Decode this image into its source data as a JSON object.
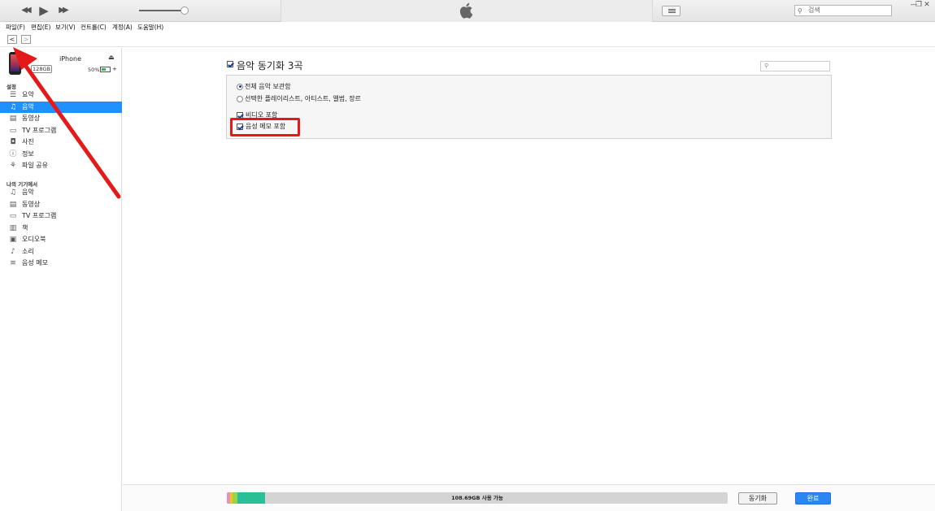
{
  "toolbar": {
    "prev_icon": "◀◀",
    "play_icon": "▶",
    "next_icon": "▶▶",
    "search_placeholder": "검색",
    "window_min": "—",
    "window_max": "❐",
    "window_close": "✕"
  },
  "menu": [
    "파일(F)",
    "편집(E)",
    "보기(V)",
    "컨트롤(C)",
    "계정(A)",
    "도움말(H)"
  ],
  "nav": {
    "back": "<",
    "forward": ">"
  },
  "device": {
    "name": "iPhone",
    "capacity": "128GB",
    "battery_percent": "50%",
    "battery_level": 0.5,
    "charging_symbol": "+"
  },
  "sidebar": {
    "settings_header": "설정",
    "settings_items": [
      {
        "icon": "☰",
        "label": "요약"
      },
      {
        "icon": "♫",
        "label": "음악"
      },
      {
        "icon": "▤",
        "label": "동영상"
      },
      {
        "icon": "▭",
        "label": "TV 프로그램"
      },
      {
        "icon": "◘",
        "label": "사진"
      },
      {
        "icon": "ⓘ",
        "label": "정보"
      },
      {
        "icon": "⚘",
        "label": "파일 공유"
      }
    ],
    "device_header": "나의 기기에서",
    "device_items": [
      {
        "icon": "♫",
        "label": "음악"
      },
      {
        "icon": "▤",
        "label": "동영상"
      },
      {
        "icon": "▭",
        "label": "TV 프로그램"
      },
      {
        "icon": "▥",
        "label": "책"
      },
      {
        "icon": "▣",
        "label": "오디오북"
      },
      {
        "icon": "♪",
        "label": "소리"
      },
      {
        "icon": "≡",
        "label": "음성 메모"
      }
    ],
    "active_index": 1
  },
  "main": {
    "sync_title": "음악 동기화 3곡",
    "sync_checked": true,
    "options": {
      "entire_library": "전체 음악 보관함",
      "selected": "선택한 플레이리스트, 아티스트, 앨범, 장르",
      "include_videos": "비디오 포함",
      "include_voice_memos": "음성 메모 포함"
    }
  },
  "footer": {
    "storage_text": "108.69GB 사용 가능",
    "sync_button": "동기화",
    "done_button": "완료",
    "segments": [
      {
        "color": "#e88ec7",
        "fraction": 0.006
      },
      {
        "color": "#f1c40f",
        "fraction": 0.005
      },
      {
        "color": "#9ad14b",
        "fraction": 0.01
      },
      {
        "color": "#2bbf98",
        "fraction": 0.056
      }
    ]
  }
}
